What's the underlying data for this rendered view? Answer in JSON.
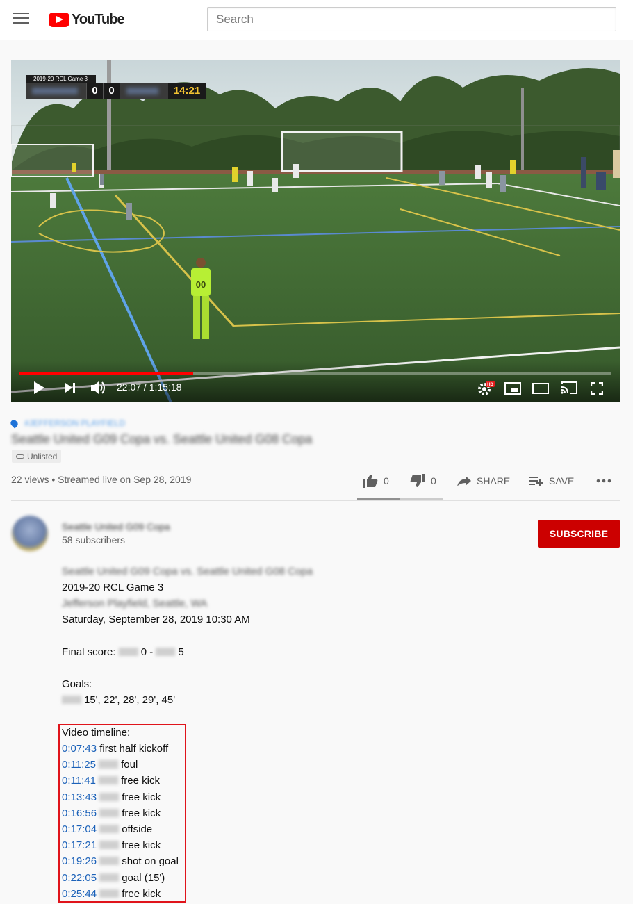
{
  "header": {
    "logo_text": "YouTube",
    "search_placeholder": "Search"
  },
  "player": {
    "scorebug": {
      "title": "2019-20 RCL Game 3",
      "home_score": "0",
      "away_score": "0",
      "clock": "14:21"
    },
    "jersey_number": "00",
    "time_readout": "22:07 / 1:15:18",
    "progress_fraction": 0.293,
    "hd_badge": "HD",
    "colors": {
      "progress": "#ff0000",
      "grass": "#3f6a33"
    }
  },
  "video": {
    "hashtag": "#JEFFERSON PLAYFIELD",
    "title": "Seattle United G09 Copa vs. Seattle United G08 Copa",
    "badge": "Unlisted",
    "views_line": "22 views • Streamed live on Sep 28, 2019",
    "likes": "0",
    "dislikes": "0",
    "share_label": "SHARE",
    "save_label": "SAVE"
  },
  "channel": {
    "name": "Seattle United G09 Copa",
    "subscribers": "58 subscribers",
    "subscribe_label": "SUBSCRIBE"
  },
  "description": {
    "line1": "Seattle United G09 Copa vs. Seattle United G08 Copa",
    "line2": "2019-20 RCL Game 3",
    "line3": "Jefferson Playfield, Seattle, WA",
    "line4": "Saturday, September 28, 2019 10:30 AM",
    "final_score_label": "Final score:",
    "final_score_home": "0 -",
    "final_score_away": "5",
    "goals_label": "Goals:",
    "goals_minutes": "15', 22', 28', 29', 45'",
    "timeline_label": "Video timeline:",
    "timeline": [
      {
        "time": "0:07:43",
        "event": "first half kickoff",
        "redacted": false
      },
      {
        "time": "0:11:25",
        "event": "foul",
        "redacted": true
      },
      {
        "time": "0:11:41",
        "event": "free kick",
        "redacted": true
      },
      {
        "time": "0:13:43",
        "event": "free kick",
        "redacted": true
      },
      {
        "time": "0:16:56",
        "event": "free kick",
        "redacted": true
      },
      {
        "time": "0:17:04",
        "event": "offside",
        "redacted": true
      },
      {
        "time": "0:17:21",
        "event": "free kick",
        "redacted": true
      },
      {
        "time": "0:19:26",
        "event": "shot on goal",
        "redacted": true
      },
      {
        "time": "0:22:05",
        "event": "goal (15')",
        "redacted": true
      },
      {
        "time": "0:25:44",
        "event": "free kick",
        "redacted": true
      }
    ]
  }
}
